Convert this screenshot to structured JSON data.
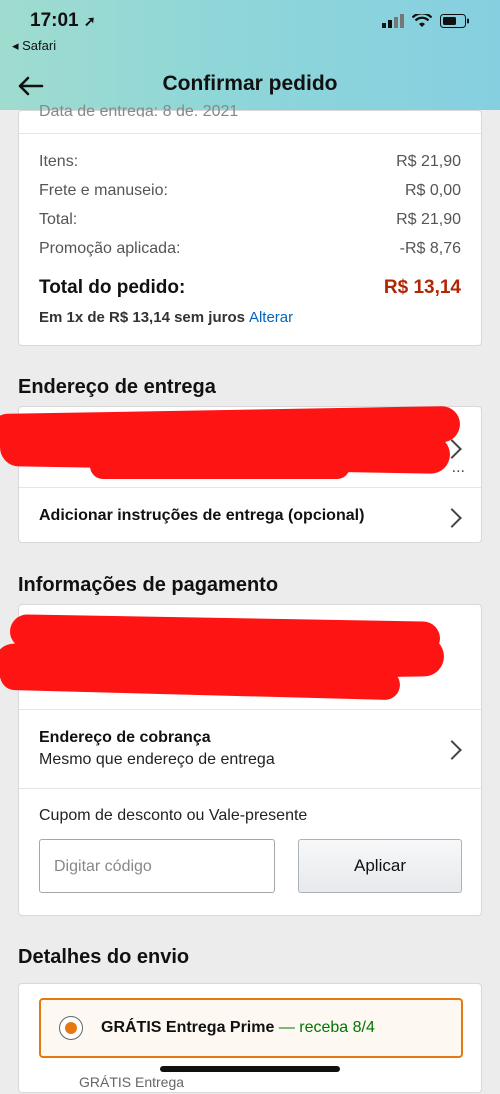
{
  "status": {
    "time": "17:01",
    "back_app": "◂ Safari"
  },
  "nav": {
    "title": "Confirmar pedido"
  },
  "summary": {
    "partial_line": "Data de entrega: 8 de. 2021",
    "items_label": "Itens:",
    "items_value": "R$ 21,90",
    "shipping_label": "Frete e manuseio:",
    "shipping_value": "R$ 0,00",
    "total_label": "Total:",
    "total_value": "R$ 21,90",
    "promo_label": "Promoção aplicada:",
    "promo_value": "-R$ 8,76",
    "order_total_label": "Total do pedido:",
    "order_total_value": "R$ 13,14",
    "installments": "Em 1x de R$ 13,14 sem juros",
    "change_link": "Alterar"
  },
  "delivery": {
    "section_title": "Endereço de entrega",
    "ellipsis": "...",
    "instructions": "Adicionar instruções de entrega (opcional)"
  },
  "payment": {
    "section_title": "Informações de pagamento",
    "billing_title": "Endereço de cobrança",
    "billing_sub": "Mesmo que endereço de entrega",
    "coupon_label": "Cupom de desconto ou Vale-presente",
    "coupon_placeholder": "Digitar código",
    "apply_button": "Aplicar"
  },
  "shipping": {
    "section_title": "Detalhes do envio",
    "option_bold": "GRÁTIS Entrega Prime",
    "option_green": " — receba 8/4",
    "partial_line": "GRÁTIS Entrega"
  },
  "colors": {
    "accent": "#e47911",
    "price": "#b12704",
    "link": "#0066c0",
    "green": "#007600",
    "redaction": "#ff1414"
  }
}
